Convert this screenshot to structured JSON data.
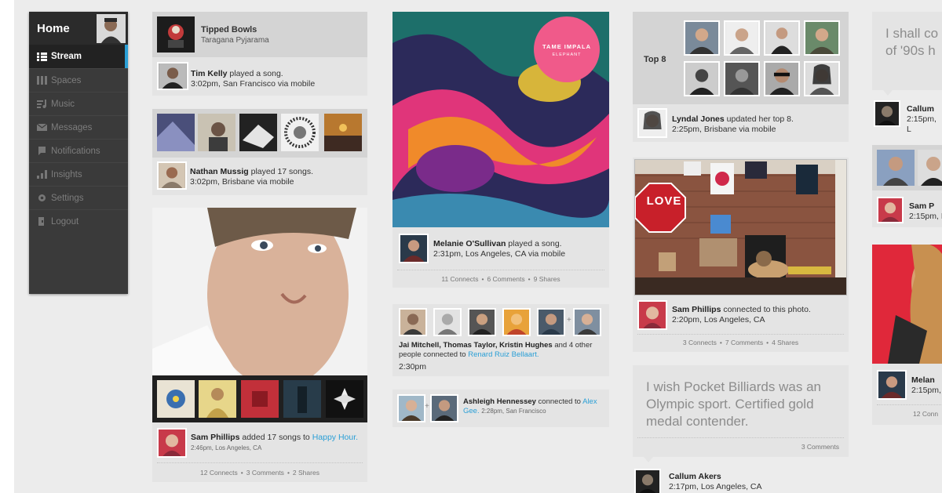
{
  "sidebar": {
    "home_label": "Home",
    "items": [
      {
        "label": "Stream",
        "icon": "stream-icon"
      },
      {
        "label": "Spaces",
        "icon": "spaces-icon"
      },
      {
        "label": "Music",
        "icon": "music-icon"
      },
      {
        "label": "Messages",
        "icon": "messages-icon"
      },
      {
        "label": "Notifications",
        "icon": "notifications-icon"
      },
      {
        "label": "Insights",
        "icon": "insights-icon"
      },
      {
        "label": "Settings",
        "icon": "settings-icon"
      },
      {
        "label": "Logout",
        "icon": "logout-icon"
      }
    ],
    "accent": "#2a9fd6"
  },
  "col1": {
    "song_card": {
      "title": "Tipped Bowls",
      "artist": "Taragana Pyjarama",
      "user": "Tim Kelly",
      "action": " played a song.",
      "meta": "3:02pm, San Francisco via mobile"
    },
    "songs_card": {
      "user": "Nathan Mussig",
      "action": " played 17 songs.",
      "meta": "3:02pm, Brisbane via mobile"
    },
    "photo_card": {
      "user": "Sam Phillips",
      "action": " added 17 songs to ",
      "playlist": "Happy Hour.",
      "meta": "2:46pm, Los Angeles, CA",
      "connects": "12 Connects",
      "comments": "3 Comments",
      "shares": "2 Shares"
    }
  },
  "col2": {
    "album_card": {
      "album_artist": "TAME IMPALA",
      "album_title": "ELEPHANT",
      "user": "Melanie O'Sullivan",
      "action": " played a song.",
      "meta": "2:31pm, Los Angeles, CA via mobile",
      "connects": "11 Connects",
      "comments": "6 Comments",
      "shares": "9 Shares"
    },
    "group_card": {
      "users": "Jai Mitchell, Thomas Taylor, Kristin Hughes",
      "action": " and 4 other people connected to ",
      "target": "Renard Ruiz Bellaart.",
      "time": "2:30pm"
    },
    "connect_card": {
      "user": "Ashleigh Hennessey",
      "action": " connected to ",
      "target": "Alex Gee.",
      "meta": "2:28pm, San Francisco"
    }
  },
  "col3": {
    "top8_card": {
      "label": "Top 8",
      "user": "Lyndal Jones",
      "action": " updated her top 8.",
      "meta": "2:25pm, Brisbane via mobile"
    },
    "photo_card": {
      "sign": "LOVE",
      "user": "Sam Phillips",
      "action": " connected to this photo.",
      "meta": "2:20pm, Los Angeles, CA",
      "connects": "3 Connects",
      "comments": "7 Comments",
      "shares": "4 Shares"
    },
    "quote_card": {
      "text": "I wish Pocket Billiards was an Olympic sport. Certified gold medal contender.",
      "comments": "3 Comments",
      "user": "Callum Akers",
      "meta": "2:17pm, Los Angeles, CA"
    }
  },
  "col4": {
    "quote_text": "I shall co of '90s h",
    "user1": "Callum",
    "meta1": "2:15pm, L",
    "user2": "Sam P",
    "meta2": "2:15pm, L",
    "user3": "Melan",
    "meta3": "2:15pm, L",
    "connects": "12 Conn"
  }
}
